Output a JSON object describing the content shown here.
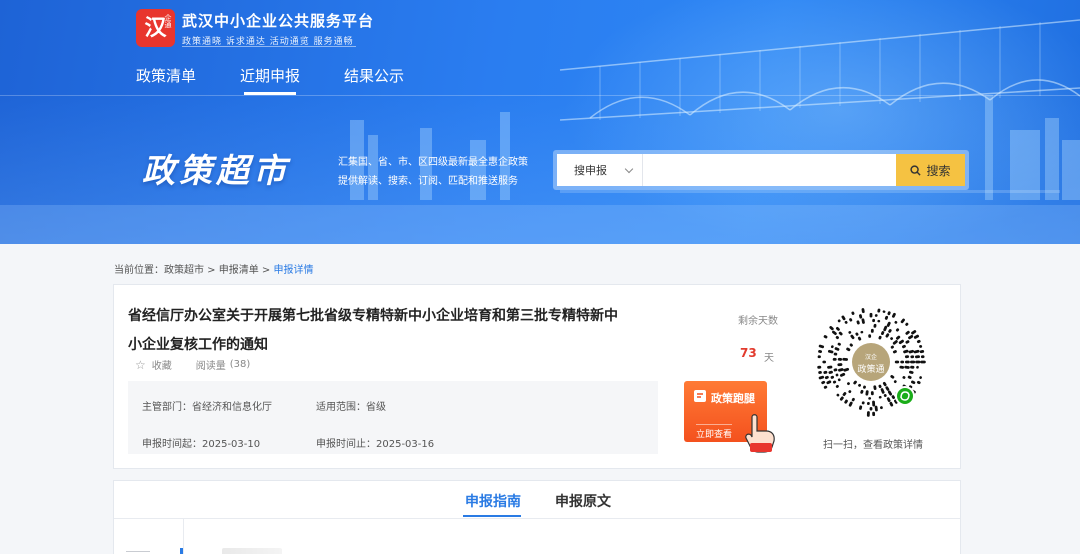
{
  "header": {
    "logo_char": "汉",
    "logo_small": "企通",
    "site_title": "武汉中小企业公共服务平台",
    "site_slogan": "政策通晓  诉求通达  活动通览  服务通畅"
  },
  "nav": {
    "items": [
      {
        "label": "政策清单",
        "active": false
      },
      {
        "label": "近期申报",
        "active": true
      },
      {
        "label": "结果公示",
        "active": false
      }
    ]
  },
  "hero": {
    "title": "政策超市",
    "desc_line1": "汇集国、省、市、区四级最新最全惠企政策",
    "desc_line2": "提供解读、搜索、订阅、匹配和推送服务"
  },
  "search": {
    "select_value": "搜申报",
    "placeholder": "",
    "button_label": "搜索"
  },
  "breadcrumb": {
    "prefix": "当前位置：",
    "items": [
      "政策超市",
      "申报清单"
    ],
    "current": "申报详情",
    "sep": " > "
  },
  "detail": {
    "title": "省经信厅办公室关于开展第七批省级专精特新中小企业培育和第三批专精特新中小企业复核工作的通知",
    "collect_label": "收藏",
    "reads_label": "阅读量",
    "reads_count": "(38)",
    "dept_label": "主管部门：",
    "dept_value": "省经济和信息化厅",
    "scope_label": "适用范围：",
    "scope_value": "省级",
    "start_label": "申报时间起：",
    "start_value": "2025-03-10",
    "end_label": "申报时间止：",
    "end_value": "2025-03-16",
    "remain_label": "剩余天数",
    "remain_days": "73",
    "remain_unit": "天"
  },
  "promo": {
    "title": "政策跑腿",
    "button": "立即查看"
  },
  "qr": {
    "center_label": "政策通",
    "caption": "扫一扫，查看政策详情"
  },
  "tabs": [
    {
      "label": "申报指南",
      "active": true
    },
    {
      "label": "申报原文",
      "active": false
    }
  ],
  "colors": {
    "primary": "#2a7be4",
    "banner": "#2a7df0",
    "accent_red": "#e23b2e",
    "search_button": "#f5c242",
    "promo_orange": "#f4511e"
  }
}
